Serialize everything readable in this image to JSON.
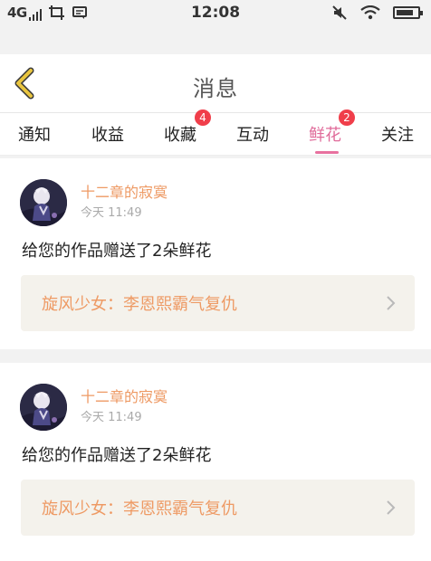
{
  "status_bar": {
    "network": "4G",
    "time": "12:08"
  },
  "header": {
    "title": "消息"
  },
  "tabs": [
    {
      "label": "通知",
      "badge": null,
      "active": false
    },
    {
      "label": "收益",
      "badge": null,
      "active": false
    },
    {
      "label": "收藏",
      "badge": "4",
      "active": false
    },
    {
      "label": "互动",
      "badge": null,
      "active": false
    },
    {
      "label": "鲜花",
      "badge": "2",
      "active": true
    },
    {
      "label": "关注",
      "badge": null,
      "active": false
    }
  ],
  "messages": [
    {
      "username": "十二章的寂寞",
      "time": "今天 11:49",
      "text": "给您的作品赠送了2朵鲜花",
      "work_title": "旋风少女：李恩熙霸气复仇"
    },
    {
      "username": "十二章的寂寞",
      "time": "今天 11:49",
      "text": "给您的作品赠送了2朵鲜花",
      "work_title": "旋风少女：李恩熙霸气复仇"
    }
  ],
  "colors": {
    "accent_pink": "#e06b9a",
    "badge_red": "#f03e4a",
    "username_orange": "#ee9a64",
    "back_icon_yellow": "#e9c53f"
  }
}
